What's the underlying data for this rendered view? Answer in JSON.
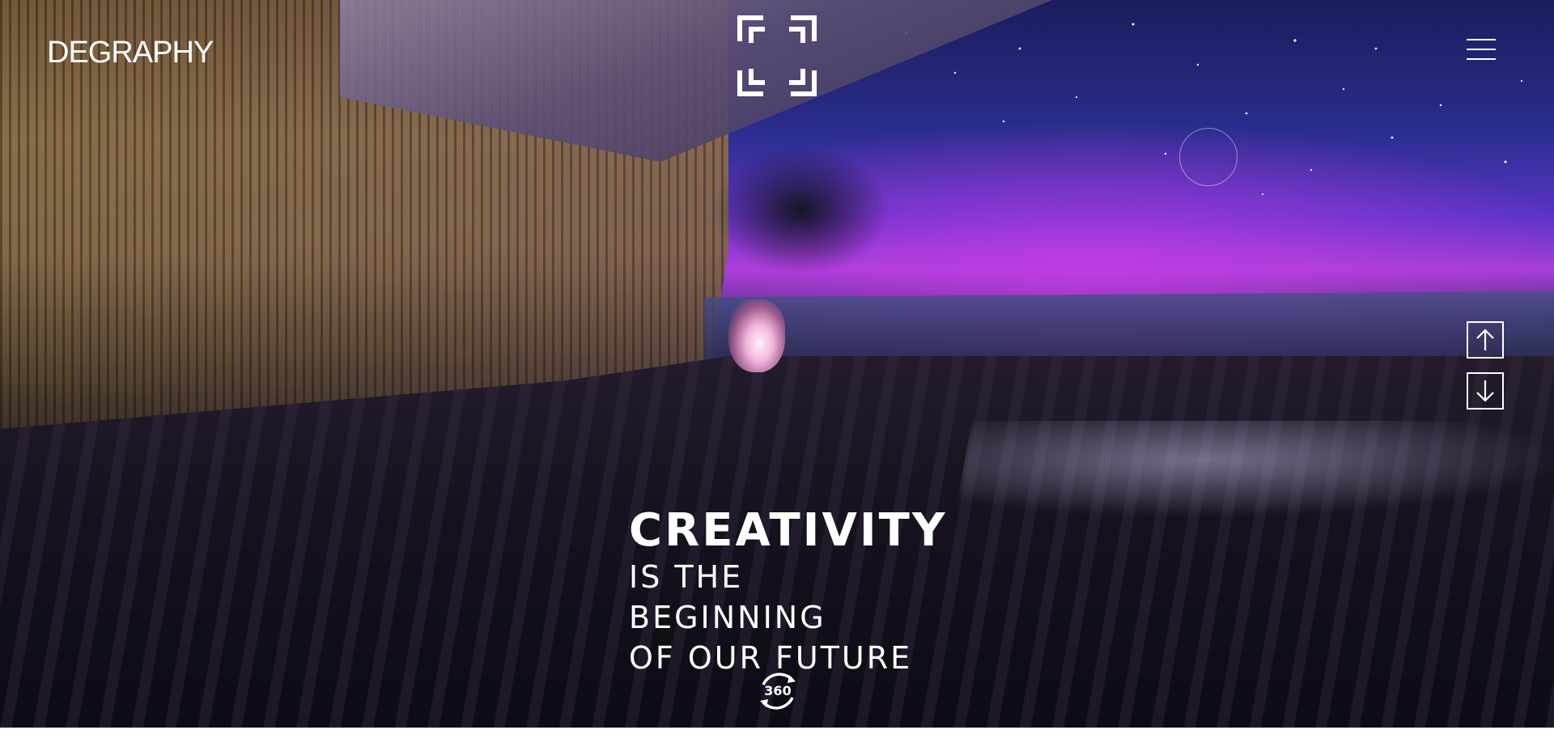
{
  "header": {
    "logo_text": "DEGRAPHY",
    "center_icon": "fullscreen-brackets-icon",
    "menu_icon": "hamburger-menu-icon"
  },
  "side_nav": {
    "up_icon": "arrow-up-icon",
    "down_icon": "arrow-down-icon"
  },
  "hero": {
    "headline": "CREATIVITY",
    "line1": "IS THE BEGINNING",
    "line2": "OF OUR FUTURE"
  },
  "badge": {
    "label": "360",
    "icon": "rotate-360-icon"
  },
  "colors": {
    "text": "#ffffff",
    "sky_purple": "#a43fd6",
    "sky_blue": "#2a2d8e"
  }
}
